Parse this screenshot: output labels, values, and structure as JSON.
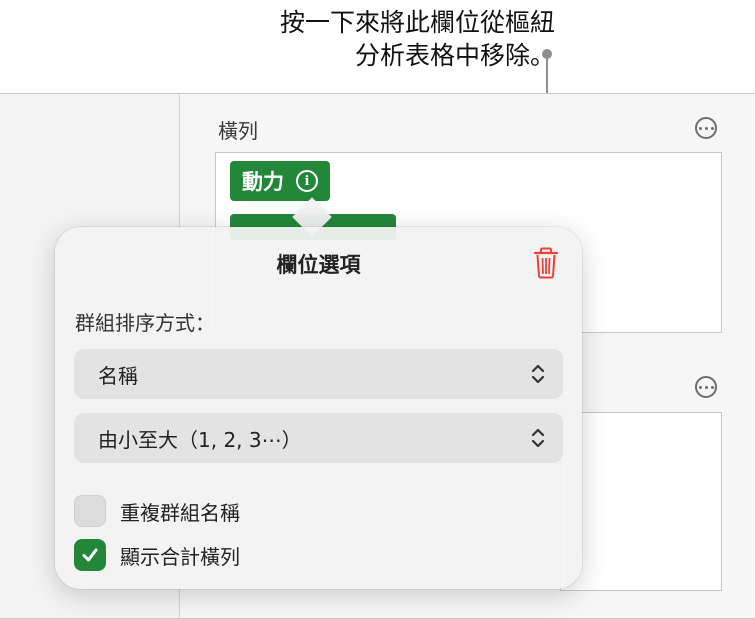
{
  "callout": {
    "line1": "按一下來將此欄位從樞紐",
    "line2": "分析表格中移除。"
  },
  "sidebar": {
    "rows_label": "橫列",
    "field_pill": "動力"
  },
  "popover": {
    "title": "欄位選項",
    "sort_label": "群組排序方式：",
    "sort_by_value": "名稱",
    "sort_order_value": "由小至大（1, 2, 3⋯）",
    "repeat_names": {
      "label": "重複群組名稱",
      "checked": false
    },
    "show_totals": {
      "label": "顯示合計橫列",
      "checked": true
    }
  },
  "colors": {
    "accent_green": "#23873a",
    "delete_red": "#e8433a"
  }
}
